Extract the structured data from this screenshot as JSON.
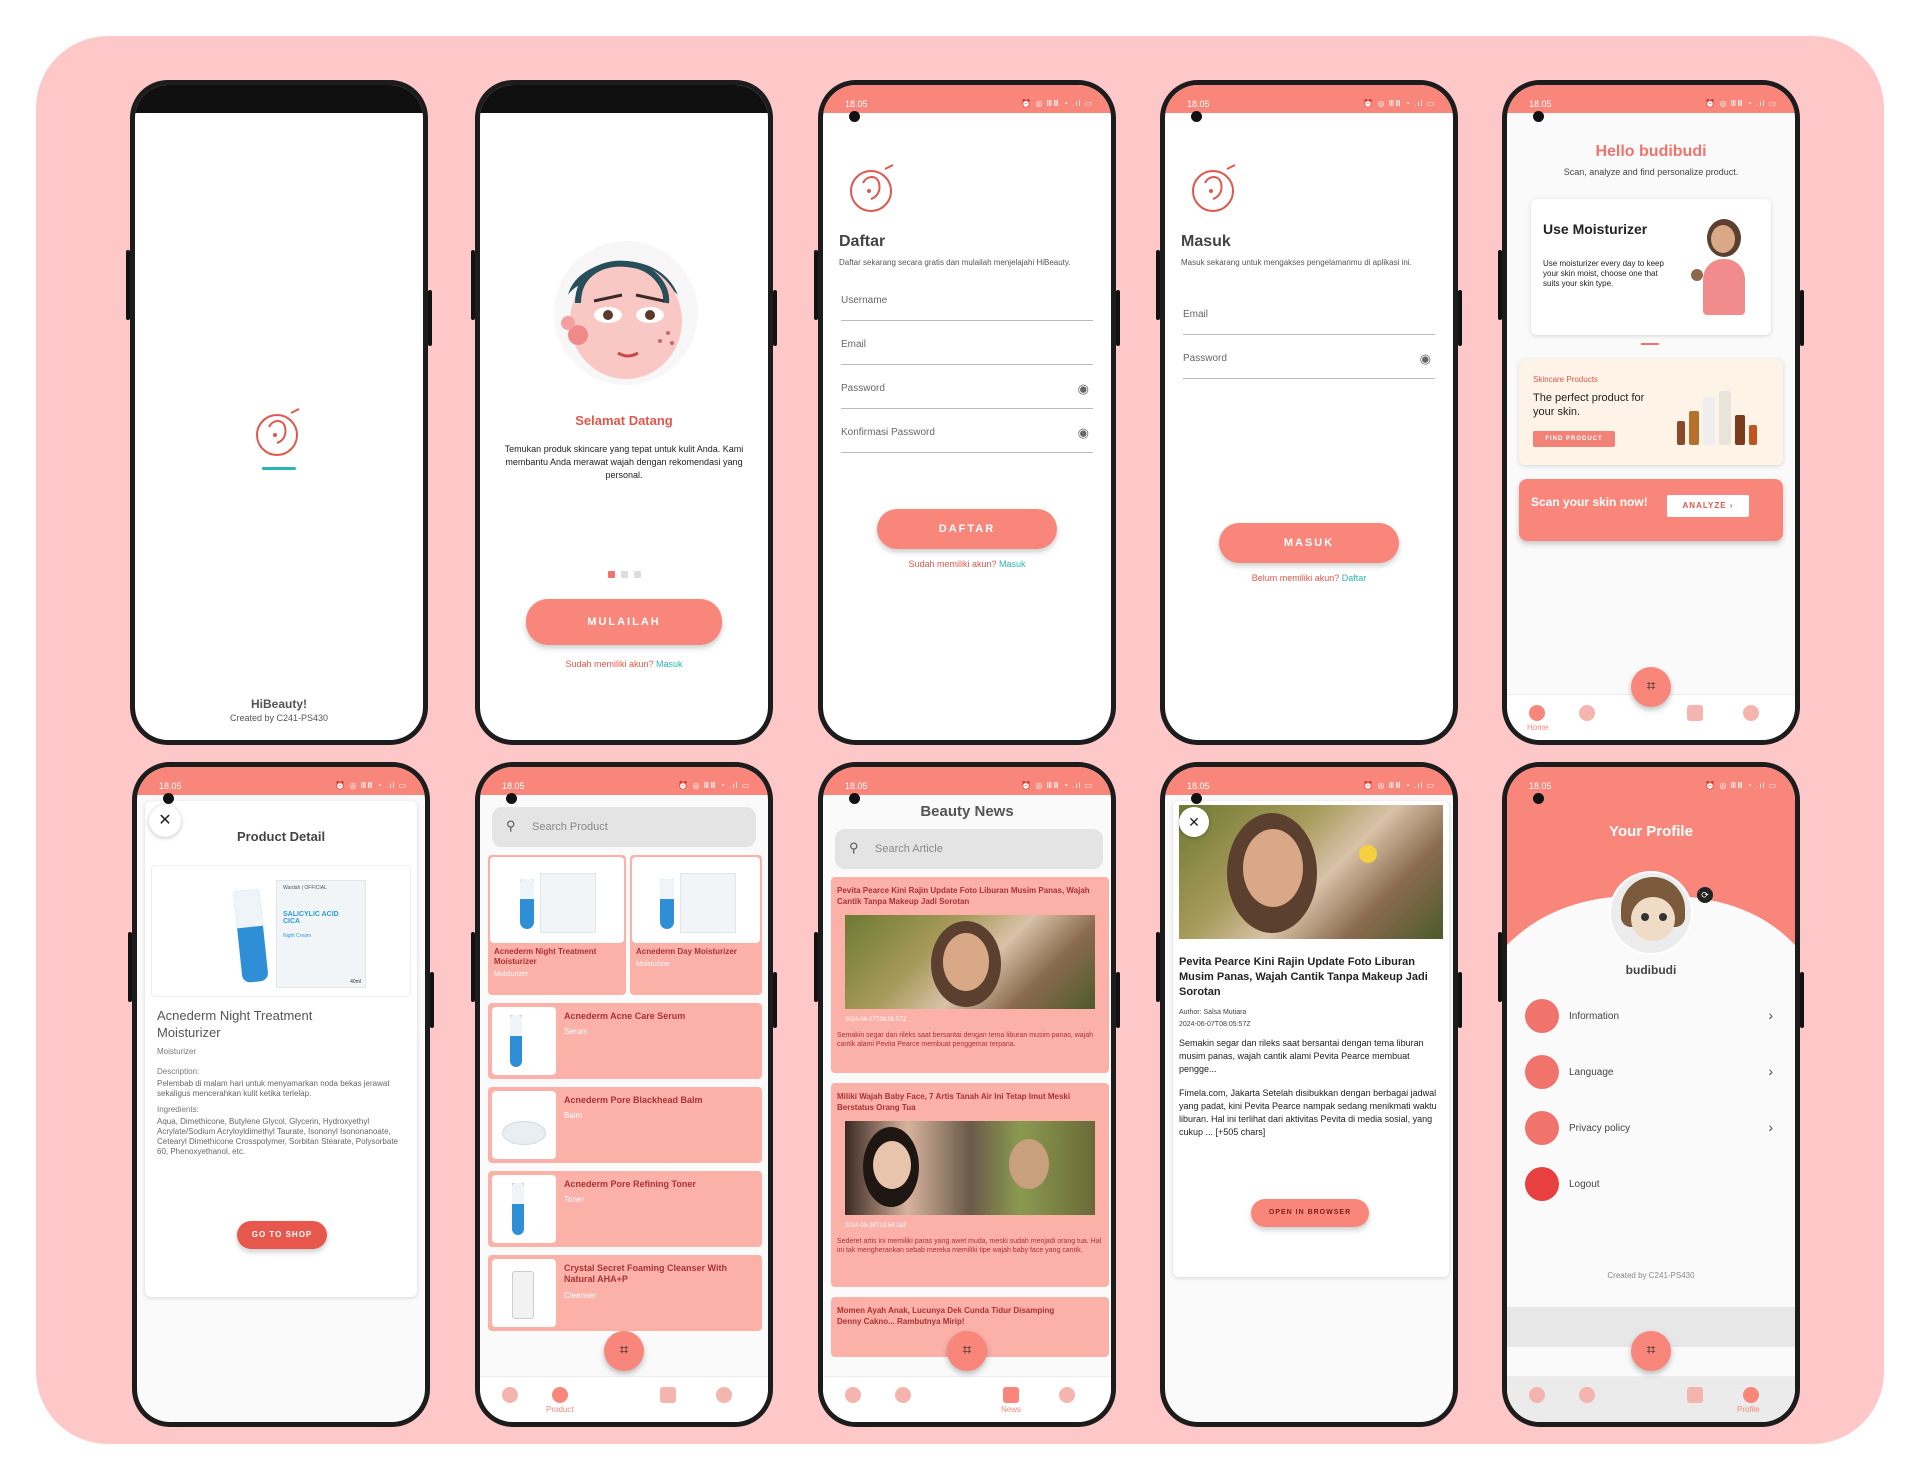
{
  "app": {
    "name": "HiBeauty!",
    "credit": "Created by C241-PS430"
  },
  "status": {
    "time": "18.05",
    "icons": "⏰ ◎ ⅢⅢ ◔ .ıl ▭"
  },
  "onboarding": {
    "title": "Selamat Datang",
    "body": "Temukan produk skincare yang tepat untuk kulit Anda. Kami membantu Anda merawat wajah dengan rekomendasi yang personal.",
    "button": "MULAILAH",
    "footer_q": "Sudah memiliki akun?",
    "footer_link": "Masuk"
  },
  "register": {
    "title": "Daftar",
    "subtitle": "Daftar sekarang secara gratis dan mulailah menjelajahi HiBeauty.",
    "f_username": "Username",
    "f_email": "Email",
    "f_password": "Password",
    "f_confirm": "Konfirmasi Password",
    "button": "DAFTAR",
    "footer_q": "Sudah memiliki akun?",
    "footer_link": "Masuk"
  },
  "login": {
    "title": "Masuk",
    "subtitle": "Masuk sekarang untuk mengakses pengelamanmu di aplikasi ini.",
    "f_email": "Email",
    "f_password": "Password",
    "button": "MASUK",
    "footer_q": "Belum memiliki akun?",
    "footer_link": "Daftar"
  },
  "home": {
    "greeting": "Hello budibudi",
    "sub": "Scan, analyze and find personalize product.",
    "tip_title": "Use Moisturizer",
    "tip_body": "Use moisturizer every day to keep your skin moist, choose one that suits your skin type.",
    "prod_tag": "Skincare Products",
    "prod_text": "The perfect product for your skin.",
    "prod_btn": "FIND PRODUCT",
    "scan_text": "Scan your skin now!",
    "scan_btn": "ANALYZE ›",
    "nav_home": "Home"
  },
  "detail": {
    "title": "Product Detail",
    "name": "Acnederm Night Treatment Moisturizer",
    "category": "Moisturizer",
    "desc_label": "Description:",
    "desc": "Pelembab di malam hari untuk menyamarkan noda bekas jerawat sekaligus mencerahkan kulit ketika terlelap.",
    "ingr_label": "Ingredients:",
    "ingr": "Aqua, Dimethicone, Butylene Glycol, Glycerin, Hydroxyethyl Acrylate/Sodium Acryloyldimethyl Taurate, Isononyl Isononanoate, Cetearyl Dimethicone Crosspolymer, Sorbitan Stearate, Polysorbate 60, Phenoxyethanol, etc.",
    "button": "GO TO SHOP",
    "pack_title": "SALICYLIC ACID CICA",
    "pack_sub": "Night Cream",
    "pack_brand": "Wardah | OFFICIAL",
    "pack_size": "40ml"
  },
  "products": {
    "search": "Search Product",
    "grid": [
      {
        "name": "Acnederm Night Treatment Moisturizer",
        "cat": "Moisturizer"
      },
      {
        "name": "Acnederm Day Moisturizer",
        "cat": "Moisturizer"
      }
    ],
    "list": [
      {
        "name": "Acnederm Acne Care Serum",
        "cat": "Serum"
      },
      {
        "name": "Acnederm Pore Blackhead Balm",
        "cat": "Balm"
      },
      {
        "name": "Acnederm Pore Refining Toner",
        "cat": "Toner"
      },
      {
        "name": "Crystal Secret Foaming Cleanser With Natural AHA+P",
        "cat": "Cleanser"
      }
    ],
    "nav_label": "Product"
  },
  "news": {
    "title": "Beauty News",
    "search": "Search Article",
    "items": [
      {
        "title": "Pevita Pearce Kini Rajin Update Foto Liburan Musim Panas, Wajah Cantik Tanpa Makeup Jadi Sorotan",
        "date": "2024-06-07T08:05:57Z",
        "excerpt": "Semakin segar dan rileks saat bersantai dengan tema liburan musim panas, wajah cantik alami Pevita Pearce membuat penggemar terpana."
      },
      {
        "title": "Miliki Wajah Baby Face, 7 Artis Tanah Air Ini Tetap Imut Meski Berstatus Orang Tua",
        "date": "2024-05-28T10:54:18Z",
        "excerpt": "Sederet artis ini memiliki paras yang awet muda, meski sudah menjadi orang tua. Hal ini tak mengherankan sebab mereka memiliki tipe wajah baby face yang cantik."
      },
      {
        "title": "Momen Ayah Anak, Lucunya Dek Cunda Tidur Disamping Denny Cakno... Rambutnya Mirip!",
        "date": "",
        "excerpt": ""
      }
    ],
    "nav_label": "News"
  },
  "article": {
    "title": "Pevita Pearce Kini Rajin Update Foto Liburan Musim Panas, Wajah Cantik Tanpa Makeup Jadi Sorotan",
    "author": "Author: Salsa Mutiara",
    "date": "2024-06-07T08:05:57Z",
    "p1": "Semakin segar dan rileks saat bersantai dengan tema liburan musim panas, wajah cantik alami Pevita Pearce membuat pengge...",
    "p2": "Fimela.com, Jakarta Setelah disibukkan dengan berbagai jadwal yang padat, kini Pevita Pearce nampak sedang menikmati waktu liburan. Hal ini terlihat dari aktivitas Pevita di media sosial, yang cukup ... [+505 chars]",
    "button": "OPEN IN BROWSER"
  },
  "profile": {
    "title": "Your Profile",
    "username": "budibudi",
    "menu": [
      "Information",
      "Language",
      "Privacy policy",
      "Logout"
    ],
    "credit": "Created by C241-PS430",
    "nav_label": "Profile"
  },
  "colors": {
    "board": "#fec8c8",
    "accent": "#f9867a",
    "accent_dark": "#e0574c",
    "link": "#2ab5b5",
    "card": "#fbb0a8"
  }
}
